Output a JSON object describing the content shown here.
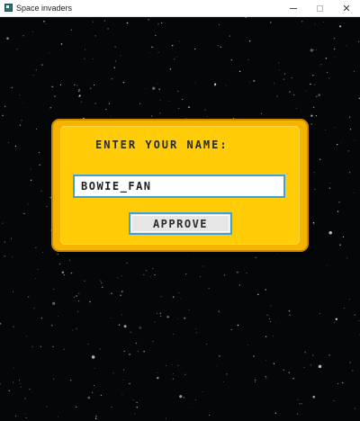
{
  "window": {
    "title": "Space invaders",
    "icon": "app-window-icon",
    "controls": {
      "minimize_icon": "minimize-icon",
      "maximize_icon": "maximize-icon",
      "close_icon": "close-icon",
      "close_glyph": "✕"
    }
  },
  "dialog": {
    "heading": "ENTER YOUR NAME:",
    "name_input_value": "BOWIE_FAN",
    "approve_label": "APPROVE"
  },
  "colors": {
    "space_background": "#050608",
    "dialog_yellow": "#ffcc07",
    "dialog_border": "#c98800",
    "input_border": "#3ea2d9",
    "button_face": "#e6e6e6"
  }
}
